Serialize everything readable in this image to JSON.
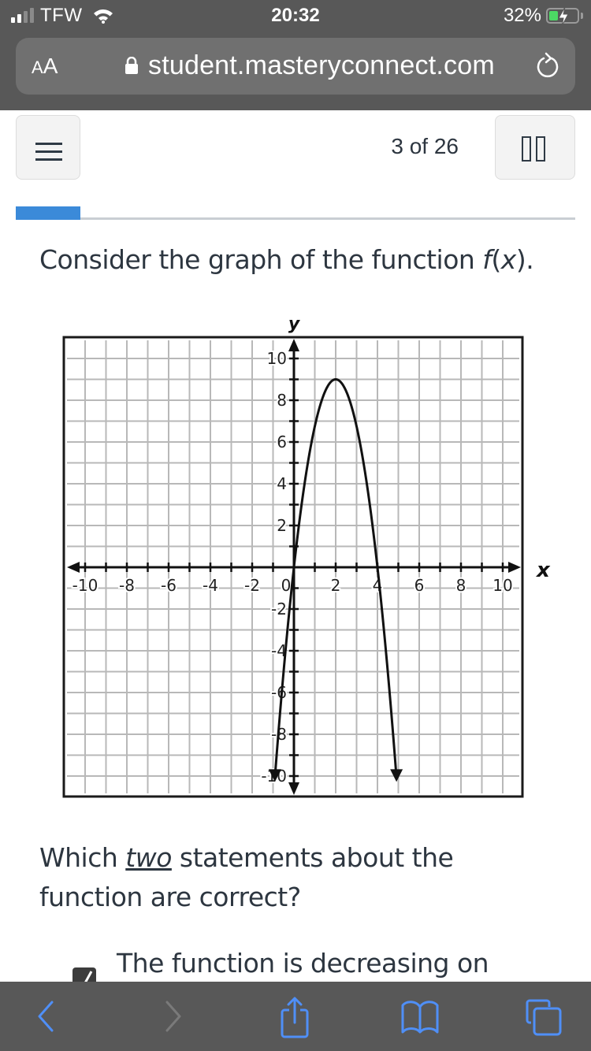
{
  "status_bar": {
    "carrier": "TFW",
    "time": "20:32",
    "battery_percent": "32%",
    "battery_level": 0.32,
    "charging": true
  },
  "browser": {
    "text_size_label_small": "A",
    "text_size_label_large": "A",
    "url": "student.masteryconnect.com",
    "icons": [
      "lock-icon",
      "reload-icon"
    ]
  },
  "app_header": {
    "menu_icon": "hamburger-menu-icon",
    "question_counter": "3 of 26",
    "pause_icon": "pause-icon",
    "progress_fraction": 0.115
  },
  "question": {
    "intro_prefix": "Consider the graph of the function ",
    "intro_func": "f",
    "intro_paren_open": "(",
    "intro_var": "x",
    "intro_suffix": ").",
    "prompt_prefix": "Which ",
    "prompt_emphasis": "two",
    "prompt_suffix": " statements about the function are correct?",
    "options": [
      {
        "text": "The function is decreasing on",
        "checked": true
      }
    ]
  },
  "chart_data": {
    "type": "line",
    "title": "",
    "xlabel": "x",
    "ylabel": "y",
    "xlim": [
      -10,
      10
    ],
    "ylim": [
      -10,
      10
    ],
    "grid": true,
    "x_tick_labels": [
      "-10",
      "-8",
      "-6",
      "-4",
      "-2",
      "0",
      "2",
      "4",
      "6",
      "8",
      "10"
    ],
    "y_tick_labels": [
      "10",
      "8",
      "6",
      "4",
      "2",
      "-2",
      "-4",
      "-6",
      "-8",
      "-10"
    ],
    "series": [
      {
        "name": "f(x)",
        "equation": "f(x) = -2.25(x - 2)^2 + 9",
        "vertex": [
          2,
          9
        ],
        "x_intercepts": [
          0,
          4
        ],
        "points": [
          [
            -0.91,
            -10
          ],
          [
            -0.5,
            -5.06
          ],
          [
            0,
            0
          ],
          [
            0.5,
            3.94
          ],
          [
            1,
            6.75
          ],
          [
            1.5,
            8.44
          ],
          [
            2,
            9
          ],
          [
            2.5,
            8.44
          ],
          [
            3,
            6.75
          ],
          [
            3.5,
            3.94
          ],
          [
            4,
            0
          ],
          [
            4.5,
            -5.06
          ],
          [
            4.91,
            -10
          ]
        ],
        "arrows_at_ends": true
      }
    ]
  },
  "toolbar": {
    "icons": [
      "back-icon",
      "forward-icon",
      "share-icon",
      "bookmarks-icon",
      "tabs-icon"
    ],
    "accent": "#4f8ff7",
    "disabled": "#7a7a7a"
  }
}
